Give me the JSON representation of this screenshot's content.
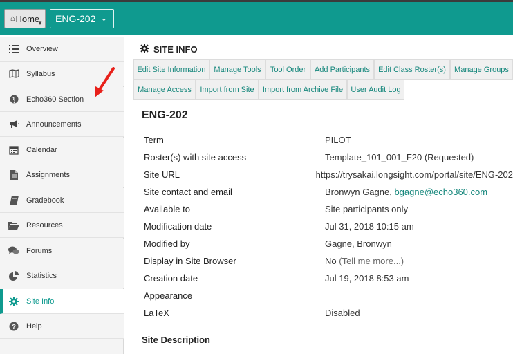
{
  "topbar": {
    "home_label": "Home",
    "site_label": "ENG-202"
  },
  "sidebar": {
    "items": [
      {
        "label": "Overview",
        "icon": "list-icon"
      },
      {
        "label": "Syllabus",
        "icon": "map-icon"
      },
      {
        "label": "Echo360 Section",
        "icon": "globe-icon"
      },
      {
        "label": "Announcements",
        "icon": "megaphone-icon"
      },
      {
        "label": "Calendar",
        "icon": "calendar-icon"
      },
      {
        "label": "Assignments",
        "icon": "file-icon"
      },
      {
        "label": "Gradebook",
        "icon": "book-icon"
      },
      {
        "label": "Resources",
        "icon": "folder-open-icon"
      },
      {
        "label": "Forums",
        "icon": "comments-icon"
      },
      {
        "label": "Statistics",
        "icon": "pie-chart-icon"
      },
      {
        "label": "Site Info",
        "icon": "gear-icon",
        "active": true
      },
      {
        "label": "Help",
        "icon": "question-icon"
      }
    ]
  },
  "page": {
    "title": "SITE INFO",
    "tabs_row1": [
      "Edit Site Information",
      "Manage Tools",
      "Tool Order",
      "Add Participants",
      "Edit Class Roster(s)",
      "Manage Groups"
    ],
    "tabs_row2": [
      "Manage Access",
      "Import from Site",
      "Import from Archive File",
      "User Audit Log"
    ],
    "site_name": "ENG-202",
    "info": [
      {
        "label": "Term",
        "value": "PILOT"
      },
      {
        "label": "Roster(s) with site access",
        "value": "Template_101_001_F20 (Requested)"
      },
      {
        "label": "Site URL",
        "value": "https://trysakai.longsight.com/portal/site/ENG-202"
      },
      {
        "label": "Site contact and email",
        "value": "Bronwyn Gagne, ",
        "link": "bgagne@echo360.com"
      },
      {
        "label": "Available to",
        "value": "Site participants only"
      },
      {
        "label": "Modification date",
        "value": "Jul 31, 2018 10:15 am"
      },
      {
        "label": "Modified by",
        "value": "Gagne, Bronwyn"
      },
      {
        "label": "Display in Site Browser",
        "value": "No ",
        "link": "(Tell me more...)"
      },
      {
        "label": "Creation date",
        "value": "Jul 19, 2018 8:53 am"
      },
      {
        "label": "Appearance",
        "value": ""
      },
      {
        "label": "LaTeX",
        "value": "Disabled"
      }
    ],
    "description_heading": "Site Description"
  },
  "colors": {
    "brand_teal": "#0f9a8f",
    "link_teal": "#16877c",
    "arrow_red": "#e8201a"
  }
}
